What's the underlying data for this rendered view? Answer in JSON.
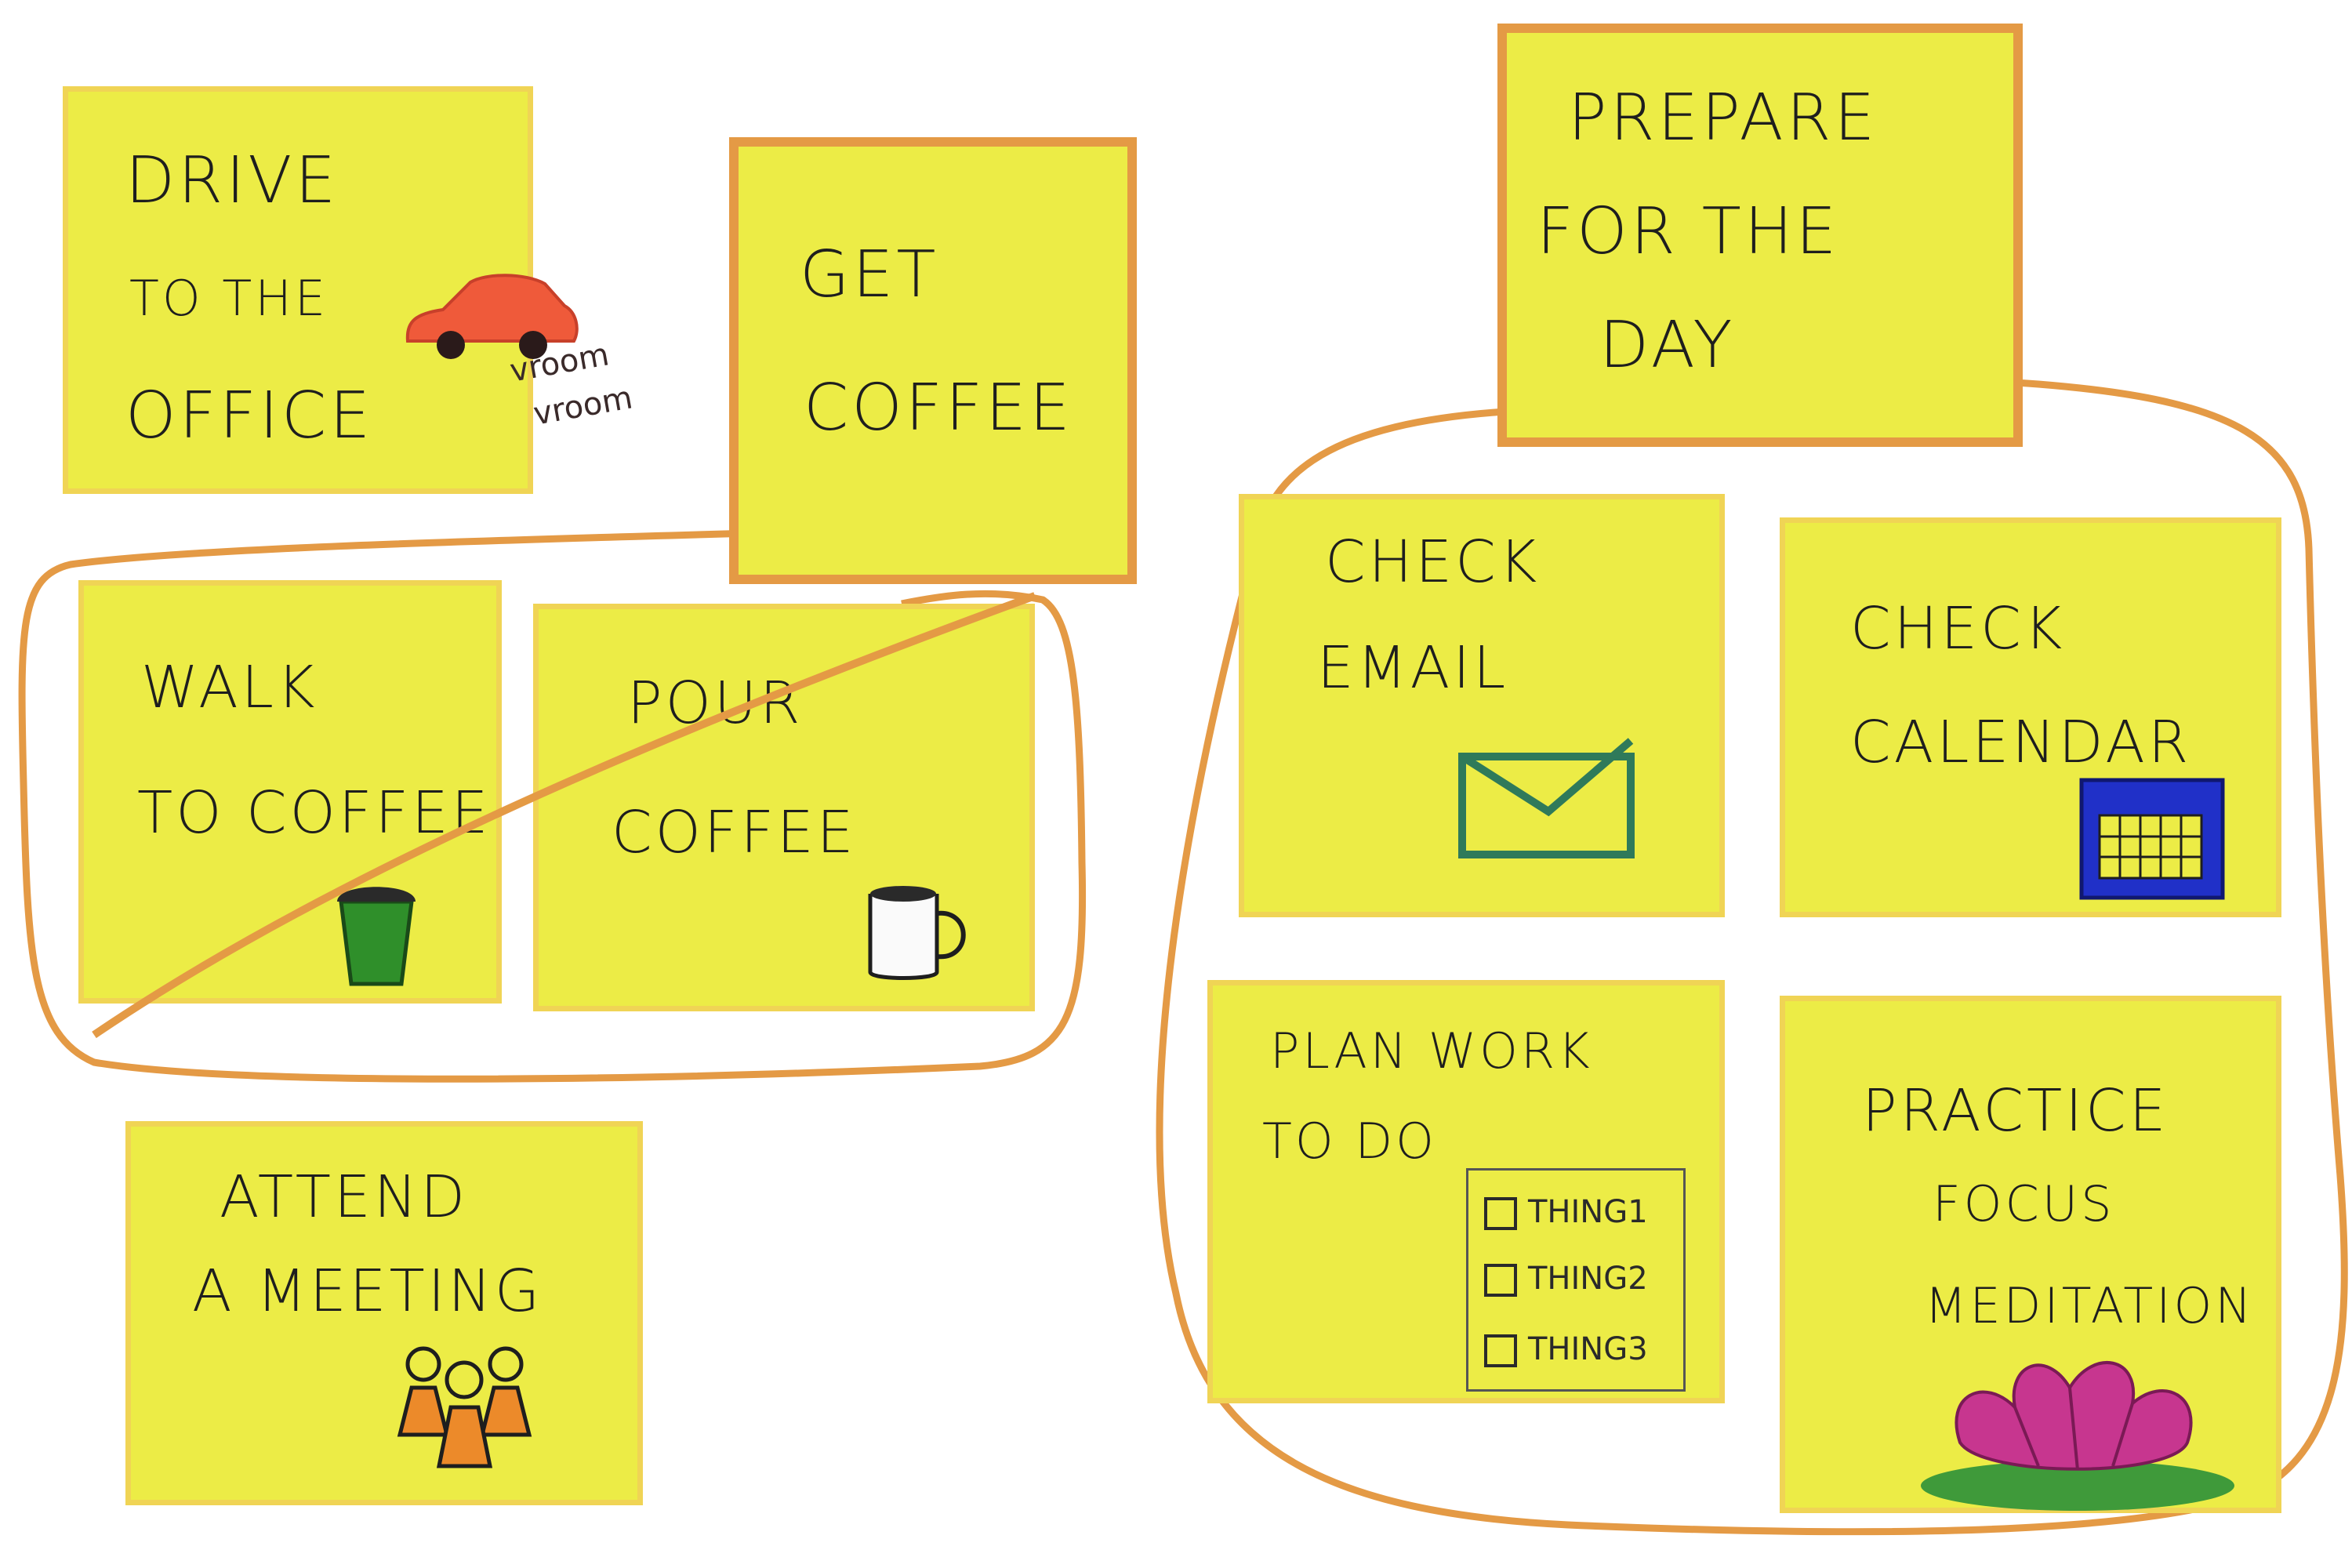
{
  "notes": {
    "drive": {
      "line1": "Drive",
      "line2": "to the",
      "line3": "Office",
      "sound1": "vroom",
      "sound2": "vroom"
    },
    "get_coffee": {
      "line1": "Get",
      "line2": "Coffee"
    },
    "walk": {
      "line1": "Walk",
      "line2": "To Coffee"
    },
    "pour": {
      "line1": "Pour",
      "line2": "Coffee"
    },
    "attend": {
      "line1": "Attend",
      "line2": "A Meeting"
    },
    "prepare": {
      "line1": "Prepare",
      "line2": "For the",
      "line3": "Day"
    },
    "email": {
      "line1": "Check",
      "line2": "Email"
    },
    "calendar": {
      "line1": "Check",
      "line2": "Calendar"
    },
    "plan": {
      "line1": "Plan Work",
      "line2": "To Do",
      "items": [
        "Thing1",
        "Thing2",
        "Thing3"
      ]
    },
    "focus": {
      "line1": "Practice",
      "line2": "Focus",
      "line3": "Meditation"
    }
  },
  "icons": [
    "car-icon",
    "coffee-cup-icon",
    "mug-icon",
    "people-icon",
    "envelope-icon",
    "calendar-icon",
    "checklist-icon",
    "lotus-icon"
  ],
  "colors": {
    "note": "#ecec46",
    "note_border": "#f0d455",
    "group_line": "#e49a45",
    "car": "#ef5a3a",
    "cup": "#2f8f2a",
    "envelope": "#2f7a5a",
    "calendar": "#2030c8",
    "lotus": "#c7368f",
    "leaf": "#3f9a3a",
    "people": "#ec8a2a"
  }
}
